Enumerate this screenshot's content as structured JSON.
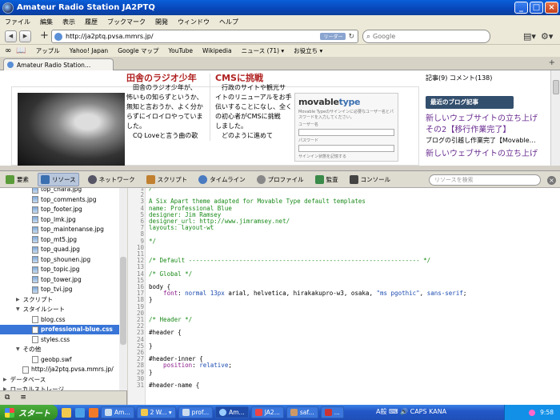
{
  "window": {
    "title": "Amateur Radio Station JA2PTQ"
  },
  "menu": [
    "ファイル",
    "編集",
    "表示",
    "履歴",
    "ブックマーク",
    "開発",
    "ウィンドウ",
    "ヘルプ"
  ],
  "nav": {
    "url": "http://ja2ptq.pvsa.mmrs.jp/",
    "reader_label": "リーダー",
    "search_placeholder": "Google"
  },
  "bookmarks": [
    "アップル",
    "Yahoo! Japan",
    "Google マップ",
    "YouTube",
    "Wikipedia",
    "ニュース (71) ▾",
    "お役立ち ▾"
  ],
  "tab": {
    "title": "Amateur Radio Station…"
  },
  "page": {
    "col1_heading": "田舎のラジオ少年",
    "col1_lines": [
      "　田舎のラジオ少年が、",
      "怖いもの知らずというか、",
      "無知と言おうか、よく分か",
      "らずにイロイロやっていま",
      "した。",
      "　CQ Loveと言う曲の歌"
    ],
    "col2_heading": "CMSに挑戦",
    "col2_lines": [
      "　行政のサイトや観光サ",
      "イトのリニューアルをお手",
      "伝いすることになし、全く",
      "の初心者がCMSに挑戦",
      "しました。",
      "　どのように進めて"
    ],
    "mt_logo_a": "movable",
    "mt_logo_b": "type",
    "mt_note": "Movable Typeのサインインに必要なユーザー名とパスワードを入力してください。",
    "mt_user": "ユーザー名",
    "mt_pass": "パスワード",
    "mt_remember": "サインイン状態を記憶する",
    "side_top": "記事(9) コメント(138)",
    "side_heading": "最近のブログ記事",
    "side_link1": "新しいウェブサイトの立ち上げ",
    "side_link1b": "その2【移行作業完了】",
    "side_text1": "ブログの引越し作業完了【Movable…",
    "side_link2": "新しいウェブサイトの立ち上げ"
  },
  "devtools": {
    "tabs": [
      "要素",
      "リソース",
      "ネットワーク",
      "スクリプト",
      "タイムライン",
      "プロファイル",
      "監査",
      "コンソール"
    ],
    "active_tab": 1,
    "search_placeholder": "リソースを検索"
  },
  "tree": [
    {
      "label": "top_chara.jpg",
      "kind": "img",
      "indent": 40
    },
    {
      "label": "top_comments.jpg",
      "kind": "img",
      "indent": 40
    },
    {
      "label": "top_footer.jpg",
      "kind": "img",
      "indent": 40
    },
    {
      "label": "top_lmk.jpg",
      "kind": "img",
      "indent": 40
    },
    {
      "label": "top_maintenanse.jpg",
      "kind": "img",
      "indent": 40
    },
    {
      "label": "top_mt5.jpg",
      "kind": "img",
      "indent": 40
    },
    {
      "label": "top_quad.jpg",
      "kind": "img",
      "indent": 40
    },
    {
      "label": "top_shounen.jpg",
      "kind": "img",
      "indent": 40
    },
    {
      "label": "top_topic.jpg",
      "kind": "img",
      "indent": 40
    },
    {
      "label": "top_tower.jpg",
      "kind": "img",
      "indent": 40
    },
    {
      "label": "top_tvi.jpg",
      "kind": "img",
      "indent": 40
    },
    {
      "label": "スクリプト",
      "kind": "folder-closed",
      "indent": 20
    },
    {
      "label": "スタイルシート",
      "kind": "folder-open",
      "indent": 20
    },
    {
      "label": "blog.css",
      "kind": "file",
      "indent": 40
    },
    {
      "label": "professional-blue.css",
      "kind": "file-selected",
      "indent": 40
    },
    {
      "label": "styles.css",
      "kind": "file",
      "indent": 40
    },
    {
      "label": "その他",
      "kind": "folder-open",
      "indent": 20
    },
    {
      "label": "geobp.swf",
      "kind": "file",
      "indent": 40
    },
    {
      "label": "http://ja2ptq.pvsa.mmrs.jp/",
      "kind": "file",
      "indent": 28
    },
    {
      "label": "データベース",
      "kind": "folder-closed",
      "indent": 4
    },
    {
      "label": "ローカルストレージ",
      "kind": "folder-closed",
      "indent": 4
    }
  ],
  "code": [
    {
      "n": "1",
      "parts": [
        [
          "cm",
          "/*"
        ]
      ]
    },
    {
      "n": "2",
      "parts": []
    },
    {
      "n": "3",
      "parts": [
        [
          "cm",
          "A Six Apart theme adapted for Movable Type default templates"
        ]
      ]
    },
    {
      "n": "4",
      "parts": [
        [
          "cm",
          "name: Professional Blue"
        ]
      ]
    },
    {
      "n": "5",
      "parts": [
        [
          "cm",
          "designer: Jim Ramsey"
        ]
      ]
    },
    {
      "n": "6",
      "parts": [
        [
          "cm",
          "designer_url: http://www.jimramsey.net/"
        ]
      ]
    },
    {
      "n": "7",
      "parts": [
        [
          "cm",
          "layouts: layout-wt"
        ]
      ]
    },
    {
      "n": "8",
      "parts": []
    },
    {
      "n": "9",
      "parts": [
        [
          "cm",
          "*/"
        ]
      ]
    },
    {
      "n": "10",
      "parts": []
    },
    {
      "n": "11",
      "parts": []
    },
    {
      "n": "12",
      "parts": [
        [
          "cm",
          "/* Default ---------------------------------------------------------------- */"
        ]
      ]
    },
    {
      "n": "13",
      "parts": []
    },
    {
      "n": "14",
      "parts": [
        [
          "cm",
          "/* Global */"
        ]
      ]
    },
    {
      "n": "15",
      "parts": []
    },
    {
      "n": "16",
      "parts": [
        [
          "",
          "body {"
        ]
      ]
    },
    {
      "n": "17",
      "parts": [
        [
          "kw",
          "    font"
        ],
        [
          "",
          ": "
        ],
        [
          "str",
          "normal 13px"
        ],
        [
          "",
          " arial, helvetica, hirakakupro-w3, osaka, "
        ],
        [
          "str",
          "\"ms pgothic\""
        ],
        [
          "",
          ", "
        ],
        [
          "str",
          "sans-serif"
        ],
        [
          "",
          ";"
        ]
      ]
    },
    {
      "n": "18",
      "parts": [
        [
          "",
          "}"
        ]
      ]
    },
    {
      "n": "19",
      "parts": []
    },
    {
      "n": "20",
      "parts": []
    },
    {
      "n": "21",
      "parts": [
        [
          "cm",
          "/* Header */"
        ]
      ]
    },
    {
      "n": "22",
      "parts": []
    },
    {
      "n": "23",
      "parts": [
        [
          "",
          "#header {"
        ]
      ]
    },
    {
      "n": "24",
      "parts": []
    },
    {
      "n": "25",
      "parts": [
        [
          "",
          "}"
        ]
      ]
    },
    {
      "n": "26",
      "parts": []
    },
    {
      "n": "27",
      "parts": [
        [
          "",
          "#header-inner {"
        ]
      ]
    },
    {
      "n": "28",
      "parts": [
        [
          "kw",
          "    position"
        ],
        [
          "",
          ": "
        ],
        [
          "str",
          "relative"
        ],
        [
          "",
          ";"
        ]
      ]
    },
    {
      "n": "29",
      "parts": [
        [
          "",
          "}"
        ]
      ]
    },
    {
      "n": "30",
      "parts": []
    },
    {
      "n": "31",
      "parts": [
        [
          "",
          "#header-name {"
        ]
      ]
    }
  ],
  "taskbar": {
    "start": "スタート",
    "items": [
      "Am...",
      "2 W... ▾",
      "prof...",
      "Am...",
      "JA2...",
      "saf...",
      "..."
    ],
    "ime": "A般 ⌨ 🔊 CAPS KANA",
    "clock": "9:58"
  }
}
